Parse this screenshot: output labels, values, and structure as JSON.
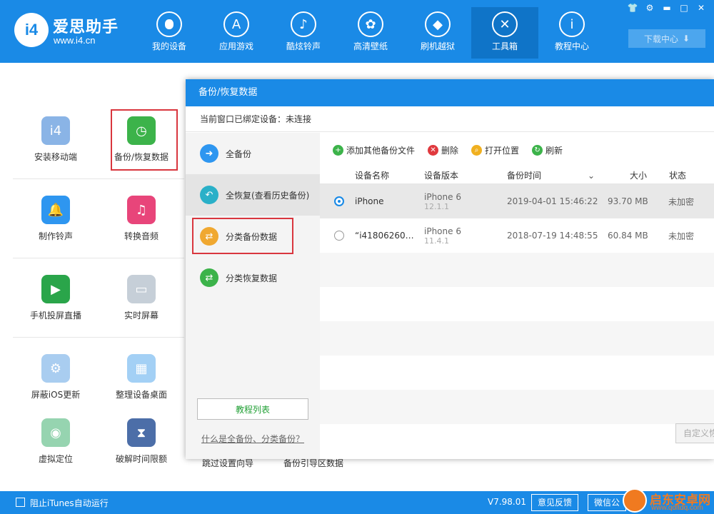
{
  "app": {
    "title": "爱思助手",
    "url": "www.i4.cn",
    "logo_text": "i4"
  },
  "nav": [
    {
      "label": "我的设备",
      "icon": "apple-icon",
      "glyph": ""
    },
    {
      "label": "应用游戏",
      "icon": "app-store-icon",
      "glyph": "A"
    },
    {
      "label": "酷炫铃声",
      "icon": "bell-icon",
      "glyph": "♪"
    },
    {
      "label": "高清壁纸",
      "icon": "flower-icon",
      "glyph": "✿"
    },
    {
      "label": "刷机越狱",
      "icon": "dropbox-icon",
      "glyph": "◆"
    },
    {
      "label": "工具箱",
      "icon": "tools-icon",
      "glyph": "✕"
    },
    {
      "label": "教程中心",
      "icon": "info-icon",
      "glyph": "i"
    }
  ],
  "nav_active": "工具箱",
  "window_controls": [
    "shirt-icon",
    "gear-icon",
    "minimize-icon",
    "maximize-icon",
    "close-icon"
  ],
  "download_center": "下载中心",
  "tools": [
    {
      "label": "安装移动端",
      "icon": "i4-mobile-icon",
      "color": "#8ab4e6"
    },
    {
      "label": "备份/恢复数据",
      "icon": "backup-restore-icon",
      "color": "#3cb34a"
    },
    {
      "label": "制作铃声",
      "icon": "bell-plus-icon",
      "color": "#2e96f0"
    },
    {
      "label": "转换音频",
      "icon": "music-icon",
      "color": "#e8457a"
    },
    {
      "label": "手机投屏直播",
      "icon": "screen-cast-icon",
      "color": "#2aa54a"
    },
    {
      "label": "实时屏幕",
      "icon": "monitor-icon",
      "color": "#c6cfd8"
    },
    {
      "label": "屏蔽iOS更新",
      "icon": "block-update-icon",
      "color": "#a9cdf0"
    },
    {
      "label": "整理设备桌面",
      "icon": "grid-icon",
      "color": "#a3d0f5"
    },
    {
      "label": "虚拟定位",
      "icon": "location-icon",
      "color": "#96d4b0"
    },
    {
      "label": "破解时间限额",
      "icon": "hourglass-icon",
      "color": "#4c6ea8"
    }
  ],
  "bottom_items": [
    "跳过设置向导",
    "备份引导区数据"
  ],
  "dialog": {
    "title": "备份/恢复数据",
    "status_label": "当前窗口已绑定设备：",
    "status_value": "未连接",
    "side": [
      {
        "label": "全备份",
        "icon": "forward-icon",
        "color": "#2e96f0"
      },
      {
        "label": "全恢复(查看历史备份)",
        "icon": "reply-icon",
        "color": "#2ab0c8"
      },
      {
        "label": "分类备份数据",
        "icon": "category-backup-icon",
        "color": "#f0a830"
      },
      {
        "label": "分类恢复数据",
        "icon": "category-restore-icon",
        "color": "#3cb34a"
      }
    ],
    "tutorial_button": "教程列表",
    "help_link": "什么是全备份、分类备份？",
    "toolbar": [
      {
        "label": "添加其他备份文件",
        "icon": "add-icon",
        "color": "#3cb34a"
      },
      {
        "label": "删除",
        "icon": "delete-icon",
        "color": "#e0393e"
      },
      {
        "label": "打开位置",
        "icon": "folder-icon",
        "color": "#f0b020"
      },
      {
        "label": "刷新",
        "icon": "refresh-icon",
        "color": "#3cb34a"
      }
    ],
    "columns": [
      "设备名称",
      "设备版本",
      "备份时间",
      "大小",
      "状态"
    ],
    "rows": [
      {
        "name": "iPhone",
        "model": "iPhone 6",
        "os": "12.1.1",
        "time": "2019-04-01 15:46:22",
        "size": "93.70 MB",
        "status": "未加密",
        "selected": true
      },
      {
        "name": "“i41806260…",
        "model": "iPhone 6",
        "os": "11.4.1",
        "time": "2018-07-19 14:48:55",
        "size": "60.84 MB",
        "status": "未加密",
        "selected": false
      }
    ],
    "custom_button": "自定义恢"
  },
  "footer": {
    "itunes_label": "阻止iTunes自动运行",
    "version": "V7.98.01",
    "feedback": "意见反馈",
    "wechat": "微信公"
  },
  "watermark": {
    "title": "启东安卓网",
    "url": "www.qdltdq.com"
  }
}
